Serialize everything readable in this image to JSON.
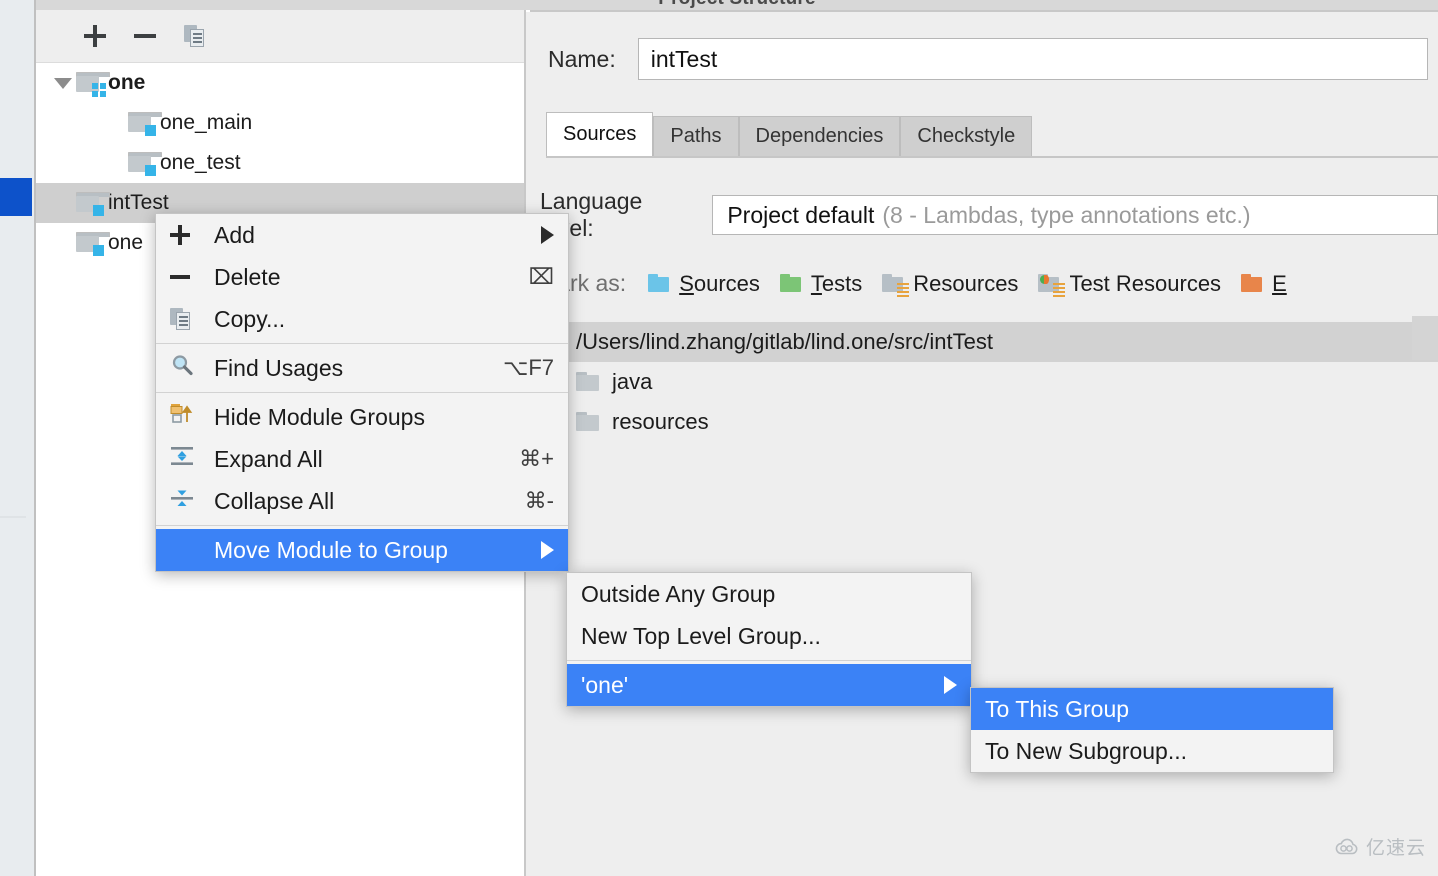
{
  "window": {
    "title": "Project Structure"
  },
  "tree_toolbar": {
    "add_icon": "plus-icon",
    "remove_icon": "minus-icon",
    "copy_icon": "copy-icon"
  },
  "module_tree": {
    "rows": [
      {
        "label": "one",
        "indent": 0,
        "bold": true,
        "expanded": true,
        "icon": "module-group-folder-icon",
        "selected": false
      },
      {
        "label": "one_main",
        "indent": 1,
        "bold": false,
        "icon": "module-folder-icon",
        "selected": false
      },
      {
        "label": "one_test",
        "indent": 1,
        "bold": false,
        "icon": "module-folder-icon",
        "selected": false
      },
      {
        "label": "intTest",
        "indent": 0,
        "bold": false,
        "icon": "module-folder-icon",
        "selected": true
      },
      {
        "label": "one",
        "indent": 0,
        "bold": false,
        "icon": "module-folder-icon",
        "selected": false
      }
    ]
  },
  "details": {
    "name_label": "Name:",
    "name_value": "intTest",
    "tabs": [
      {
        "label": "Sources",
        "active": true
      },
      {
        "label": "Paths",
        "active": false
      },
      {
        "label": "Dependencies",
        "active": false
      },
      {
        "label": "Checkstyle",
        "active": false
      }
    ],
    "language_level": {
      "label": "Language level:",
      "value": "Project default",
      "hint": "(8 - Lambdas, type annotations etc.)"
    },
    "mark_as": {
      "label": "Mark as:",
      "items": [
        {
          "label": "Sources",
          "mnemonic": "S",
          "color": "#6bc4e8",
          "icon": "sources-folder-icon"
        },
        {
          "label": "Tests",
          "mnemonic": "T",
          "color": "#7cc576",
          "icon": "tests-folder-icon"
        },
        {
          "label": "Resources",
          "mnemonic": "",
          "color": "#b6bfc6",
          "icon": "resources-folder-icon"
        },
        {
          "label": "Test Resources",
          "mnemonic": "",
          "color": "#b6bfc6",
          "icon": "test-resources-folder-icon"
        },
        {
          "label": "E",
          "mnemonic": "E",
          "color": "#e8854a",
          "icon": "excluded-folder-icon"
        }
      ]
    },
    "content_paths": [
      {
        "label": "/Users/lind.zhang/gitlab/lind.one/src/intTest",
        "highlight": true,
        "indent": false
      },
      {
        "label": "java",
        "highlight": false,
        "indent": true
      },
      {
        "label": "resources",
        "highlight": false,
        "indent": true
      }
    ]
  },
  "context_menu": {
    "items": [
      {
        "label": "Add",
        "icon": "plus-icon",
        "accel": "",
        "arrow": true,
        "highlighted": false,
        "separator_after": false
      },
      {
        "label": "Delete",
        "icon": "minus-icon",
        "accel": "⌧",
        "arrow": false,
        "highlighted": false,
        "separator_after": false
      },
      {
        "label": "Copy...",
        "icon": "copy-icon",
        "accel": "",
        "arrow": false,
        "highlighted": false,
        "separator_after": true
      },
      {
        "label": "Find Usages",
        "icon": "search-icon",
        "accel": "⌥F7",
        "arrow": false,
        "highlighted": false,
        "separator_after": true
      },
      {
        "label": "Hide Module Groups",
        "icon": "hide-module-groups-icon",
        "accel": "",
        "arrow": false,
        "highlighted": false,
        "separator_after": false
      },
      {
        "label": "Expand All",
        "icon": "expand-all-icon",
        "accel": "⌘+",
        "arrow": false,
        "highlighted": false,
        "separator_after": false
      },
      {
        "label": "Collapse All",
        "icon": "collapse-all-icon",
        "accel": "⌘-",
        "arrow": false,
        "highlighted": false,
        "separator_after": true
      },
      {
        "label": "Move Module to Group",
        "icon": "",
        "accel": "",
        "arrow": true,
        "highlighted": true,
        "separator_after": false
      }
    ]
  },
  "submenu_group": {
    "items": [
      {
        "label": "Outside Any Group",
        "arrow": false,
        "highlighted": false,
        "separator_after": false
      },
      {
        "label": "New Top Level Group...",
        "arrow": false,
        "highlighted": false,
        "separator_after": true
      },
      {
        "label": "'one'",
        "arrow": true,
        "highlighted": true,
        "separator_after": false
      }
    ]
  },
  "submenu_this_group": {
    "items": [
      {
        "label": "To This Group",
        "arrow": false,
        "highlighted": true,
        "separator_after": false
      },
      {
        "label": "To New Subgroup...",
        "arrow": false,
        "highlighted": false,
        "separator_after": false
      }
    ]
  },
  "watermark": {
    "text": "亿速云",
    "icon": "cloud-icon"
  },
  "colors": {
    "accent_blue": "#3b82f6",
    "rail_selection": "#0d52ca",
    "selection_gray": "#cfcfcf"
  }
}
